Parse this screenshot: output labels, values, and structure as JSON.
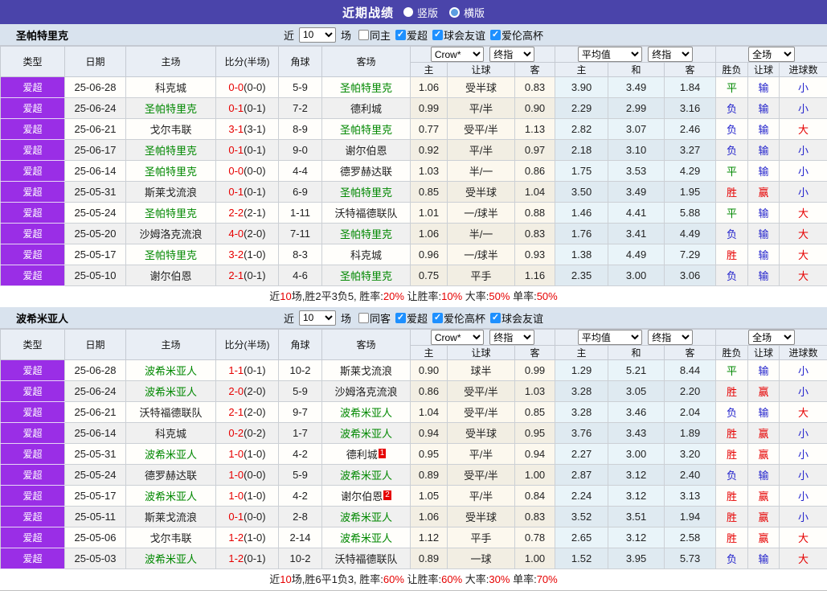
{
  "colors": {
    "topbar_bg": "#4a44aa",
    "type_cell_bg": "#9a2ee6",
    "filter_bg": "#d9e3ee",
    "header_bg": "#e9eef5",
    "team_green": "#008800",
    "red": "#e60000",
    "blue": "#2222cc",
    "checkbox_blue": "#1e90ff"
  },
  "header": {
    "title": "近期战绩",
    "layout_options": [
      {
        "label": "竖版",
        "selected": true
      },
      {
        "label": "横版",
        "selected": false
      }
    ]
  },
  "table_columns": {
    "type": "类型",
    "date": "日期",
    "home": "主场",
    "score": "比分(半场)",
    "corner": "角球",
    "away": "客场",
    "odds_home": "主",
    "odds_handicap": "让球",
    "odds_away": "客",
    "avg_home": "主",
    "avg_draw": "和",
    "avg_away": "客",
    "result_winloss": "胜负",
    "result_handicap": "让球",
    "result_goals": "进球数",
    "dropdown_bookmaker": "Crow*",
    "dropdown_final_1": "终指",
    "dropdown_average": "平均值",
    "dropdown_final_2": "终指",
    "dropdown_scope": "全场"
  },
  "sections": [
    {
      "team": "圣帕特里克",
      "filter": {
        "near_label": "近",
        "count": "10",
        "matches_label": "场",
        "same_side": {
          "label": "同主",
          "checked": false
        },
        "leagues": [
          {
            "label": "爱超",
            "checked": true
          },
          {
            "label": "球会友谊",
            "checked": true
          },
          {
            "label": "爱伦高杯",
            "checked": true
          }
        ]
      },
      "rows": [
        {
          "type": "爱超",
          "date": "25-06-28",
          "home": "科克城",
          "home_highlight": false,
          "score": "0-0",
          "half": "(0-0)",
          "corner": "5-9",
          "away": "圣帕特里克",
          "away_highlight": true,
          "away_badge": "",
          "odds": [
            "1.06",
            "受半球",
            "0.83"
          ],
          "avg": [
            "3.90",
            "3.49",
            "1.84"
          ],
          "results": [
            "平",
            "输",
            "小"
          ]
        },
        {
          "type": "爱超",
          "date": "25-06-24",
          "home": "圣帕特里克",
          "home_highlight": true,
          "score": "0-1",
          "half": "(0-1)",
          "corner": "7-2",
          "away": "德利城",
          "away_highlight": false,
          "away_badge": "",
          "odds": [
            "0.99",
            "平/半",
            "0.90"
          ],
          "avg": [
            "2.29",
            "2.99",
            "3.16"
          ],
          "results": [
            "负",
            "输",
            "小"
          ]
        },
        {
          "type": "爱超",
          "date": "25-06-21",
          "home": "戈尔韦联",
          "home_highlight": false,
          "score": "3-1",
          "half": "(3-1)",
          "corner": "8-9",
          "away": "圣帕特里克",
          "away_highlight": true,
          "away_badge": "",
          "odds": [
            "0.77",
            "受平/半",
            "1.13"
          ],
          "avg": [
            "2.82",
            "3.07",
            "2.46"
          ],
          "results": [
            "负",
            "输",
            "大"
          ]
        },
        {
          "type": "爱超",
          "date": "25-06-17",
          "home": "圣帕特里克",
          "home_highlight": true,
          "score": "0-1",
          "half": "(0-1)",
          "corner": "9-0",
          "away": "谢尔伯恩",
          "away_highlight": false,
          "away_badge": "",
          "odds": [
            "0.92",
            "平/半",
            "0.97"
          ],
          "avg": [
            "2.18",
            "3.10",
            "3.27"
          ],
          "results": [
            "负",
            "输",
            "小"
          ]
        },
        {
          "type": "爱超",
          "date": "25-06-14",
          "home": "圣帕特里克",
          "home_highlight": true,
          "score": "0-0",
          "half": "(0-0)",
          "corner": "4-4",
          "away": "德罗赫达联",
          "away_highlight": false,
          "away_badge": "",
          "odds": [
            "1.03",
            "半/一",
            "0.86"
          ],
          "avg": [
            "1.75",
            "3.53",
            "4.29"
          ],
          "results": [
            "平",
            "输",
            "小"
          ]
        },
        {
          "type": "爱超",
          "date": "25-05-31",
          "home": "斯莱戈流浪",
          "home_highlight": false,
          "score": "0-1",
          "half": "(0-1)",
          "corner": "6-9",
          "away": "圣帕特里克",
          "away_highlight": true,
          "away_badge": "",
          "odds": [
            "0.85",
            "受半球",
            "1.04"
          ],
          "avg": [
            "3.50",
            "3.49",
            "1.95"
          ],
          "results": [
            "胜",
            "赢",
            "小"
          ]
        },
        {
          "type": "爱超",
          "date": "25-05-24",
          "home": "圣帕特里克",
          "home_highlight": true,
          "score": "2-2",
          "half": "(2-1)",
          "corner": "1-11",
          "away": "沃特福德联队",
          "away_highlight": false,
          "away_badge": "",
          "odds": [
            "1.01",
            "一/球半",
            "0.88"
          ],
          "avg": [
            "1.46",
            "4.41",
            "5.88"
          ],
          "results": [
            "平",
            "输",
            "大"
          ]
        },
        {
          "type": "爱超",
          "date": "25-05-20",
          "home": "沙姆洛克流浪",
          "home_highlight": false,
          "score": "4-0",
          "half": "(2-0)",
          "corner": "7-11",
          "away": "圣帕特里克",
          "away_highlight": true,
          "away_badge": "",
          "odds": [
            "1.06",
            "半/一",
            "0.83"
          ],
          "avg": [
            "1.76",
            "3.41",
            "4.49"
          ],
          "results": [
            "负",
            "输",
            "大"
          ]
        },
        {
          "type": "爱超",
          "date": "25-05-17",
          "home": "圣帕特里克",
          "home_highlight": true,
          "score": "3-2",
          "half": "(1-0)",
          "corner": "8-3",
          "away": "科克城",
          "away_highlight": false,
          "away_badge": "",
          "odds": [
            "0.96",
            "一/球半",
            "0.93"
          ],
          "avg": [
            "1.38",
            "4.49",
            "7.29"
          ],
          "results": [
            "胜",
            "输",
            "大"
          ]
        },
        {
          "type": "爱超",
          "date": "25-05-10",
          "home": "谢尔伯恩",
          "home_highlight": false,
          "score": "2-1",
          "half": "(0-1)",
          "corner": "4-6",
          "away": "圣帕特里克",
          "away_highlight": true,
          "away_badge": "",
          "odds": [
            "0.75",
            "平手",
            "1.16"
          ],
          "avg": [
            "2.35",
            "3.00",
            "3.06"
          ],
          "results": [
            "负",
            "输",
            "大"
          ]
        }
      ],
      "summary": [
        {
          "text": "近"
        },
        {
          "text": "10",
          "red": true
        },
        {
          "text": "场,胜2平3负5, 胜率:"
        },
        {
          "text": "20%",
          "red": true
        },
        {
          "text": " 让胜率:"
        },
        {
          "text": "10%",
          "red": true
        },
        {
          "text": " 大率:"
        },
        {
          "text": "50%",
          "red": true
        },
        {
          "text": " 单率:"
        },
        {
          "text": "50%",
          "red": true
        }
      ]
    },
    {
      "team": "波希米亚人",
      "filter": {
        "near_label": "近",
        "count": "10",
        "matches_label": "场",
        "same_side": {
          "label": "同客",
          "checked": false
        },
        "leagues": [
          {
            "label": "爱超",
            "checked": true
          },
          {
            "label": "爱伦高杯",
            "checked": true
          },
          {
            "label": "球会友谊",
            "checked": true
          }
        ]
      },
      "rows": [
        {
          "type": "爱超",
          "date": "25-06-28",
          "home": "波希米亚人",
          "home_highlight": true,
          "score": "1-1",
          "half": "(0-1)",
          "corner": "10-2",
          "away": "斯莱戈流浪",
          "away_highlight": false,
          "away_badge": "",
          "odds": [
            "0.90",
            "球半",
            "0.99"
          ],
          "avg": [
            "1.29",
            "5.21",
            "8.44"
          ],
          "results": [
            "平",
            "输",
            "小"
          ]
        },
        {
          "type": "爱超",
          "date": "25-06-24",
          "home": "波希米亚人",
          "home_highlight": true,
          "score": "2-0",
          "half": "(2-0)",
          "corner": "5-9",
          "away": "沙姆洛克流浪",
          "away_highlight": false,
          "away_badge": "",
          "odds": [
            "0.86",
            "受平/半",
            "1.03"
          ],
          "avg": [
            "3.28",
            "3.05",
            "2.20"
          ],
          "results": [
            "胜",
            "赢",
            "小"
          ]
        },
        {
          "type": "爱超",
          "date": "25-06-21",
          "home": "沃特福德联队",
          "home_highlight": false,
          "score": "2-1",
          "half": "(2-0)",
          "corner": "9-7",
          "away": "波希米亚人",
          "away_highlight": true,
          "away_badge": "",
          "odds": [
            "1.04",
            "受平/半",
            "0.85"
          ],
          "avg": [
            "3.28",
            "3.46",
            "2.04"
          ],
          "results": [
            "负",
            "输",
            "大"
          ]
        },
        {
          "type": "爱超",
          "date": "25-06-14",
          "home": "科克城",
          "home_highlight": false,
          "score": "0-2",
          "half": "(0-2)",
          "corner": "1-7",
          "away": "波希米亚人",
          "away_highlight": true,
          "away_badge": "",
          "odds": [
            "0.94",
            "受半球",
            "0.95"
          ],
          "avg": [
            "3.76",
            "3.43",
            "1.89"
          ],
          "results": [
            "胜",
            "赢",
            "小"
          ]
        },
        {
          "type": "爱超",
          "date": "25-05-31",
          "home": "波希米亚人",
          "home_highlight": true,
          "score": "1-0",
          "half": "(1-0)",
          "corner": "4-2",
          "away": "德利城",
          "away_highlight": false,
          "away_badge": "1",
          "odds": [
            "0.95",
            "平/半",
            "0.94"
          ],
          "avg": [
            "2.27",
            "3.00",
            "3.20"
          ],
          "results": [
            "胜",
            "赢",
            "小"
          ]
        },
        {
          "type": "爱超",
          "date": "25-05-24",
          "home": "德罗赫达联",
          "home_highlight": false,
          "score": "1-0",
          "half": "(0-0)",
          "corner": "5-9",
          "away": "波希米亚人",
          "away_highlight": true,
          "away_badge": "",
          "odds": [
            "0.89",
            "受平/半",
            "1.00"
          ],
          "avg": [
            "2.87",
            "3.12",
            "2.40"
          ],
          "results": [
            "负",
            "输",
            "小"
          ]
        },
        {
          "type": "爱超",
          "date": "25-05-17",
          "home": "波希米亚人",
          "home_highlight": true,
          "score": "1-0",
          "half": "(1-0)",
          "corner": "4-2",
          "away": "谢尔伯恩",
          "away_highlight": false,
          "away_badge": "2",
          "odds": [
            "1.05",
            "平/半",
            "0.84"
          ],
          "avg": [
            "2.24",
            "3.12",
            "3.13"
          ],
          "results": [
            "胜",
            "赢",
            "小"
          ]
        },
        {
          "type": "爱超",
          "date": "25-05-11",
          "home": "斯莱戈流浪",
          "home_highlight": false,
          "score": "0-1",
          "half": "(0-0)",
          "corner": "2-8",
          "away": "波希米亚人",
          "away_highlight": true,
          "away_badge": "",
          "odds": [
            "1.06",
            "受半球",
            "0.83"
          ],
          "avg": [
            "3.52",
            "3.51",
            "1.94"
          ],
          "results": [
            "胜",
            "赢",
            "小"
          ]
        },
        {
          "type": "爱超",
          "date": "25-05-06",
          "home": "戈尔韦联",
          "home_highlight": false,
          "score": "1-2",
          "half": "(1-0)",
          "corner": "2-14",
          "away": "波希米亚人",
          "away_highlight": true,
          "away_badge": "",
          "odds": [
            "1.12",
            "平手",
            "0.78"
          ],
          "avg": [
            "2.65",
            "3.12",
            "2.58"
          ],
          "results": [
            "胜",
            "赢",
            "大"
          ]
        },
        {
          "type": "爱超",
          "date": "25-05-03",
          "home": "波希米亚人",
          "home_highlight": true,
          "score": "1-2",
          "half": "(0-1)",
          "corner": "10-2",
          "away": "沃特福德联队",
          "away_highlight": false,
          "away_badge": "",
          "odds": [
            "0.89",
            "一球",
            "1.00"
          ],
          "avg": [
            "1.52",
            "3.95",
            "5.73"
          ],
          "results": [
            "负",
            "输",
            "大"
          ]
        }
      ],
      "summary": [
        {
          "text": "近"
        },
        {
          "text": "10",
          "red": true
        },
        {
          "text": "场,胜6平1负3, 胜率:"
        },
        {
          "text": "60%",
          "red": true
        },
        {
          "text": " 让胜率:"
        },
        {
          "text": "60%",
          "red": true
        },
        {
          "text": " 大率:"
        },
        {
          "text": "30%",
          "red": true
        },
        {
          "text": " 单率:"
        },
        {
          "text": "70%",
          "red": true
        }
      ]
    }
  ]
}
